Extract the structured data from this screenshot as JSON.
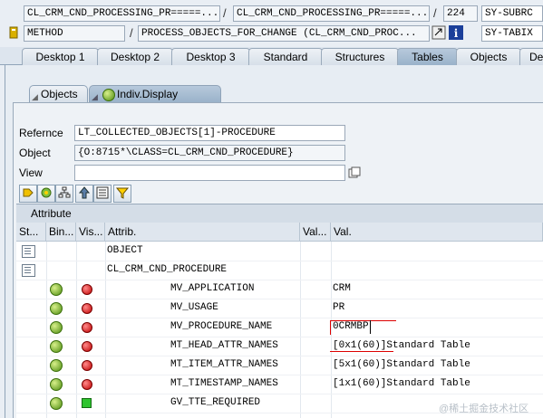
{
  "header": {
    "row1": {
      "field1": "CL_CRM_CND_PROCESSING_PR=====...",
      "field2": "CL_CRM_CND_PROCESSING_PR=====...",
      "separator": "/",
      "line": "224",
      "sysvar": "SY-SUBRC"
    },
    "row2": {
      "kind": "METHOD",
      "method": "PROCESS_OBJECTS_FOR_CHANGE (CL_CRM_CND_PROC...",
      "separator": "/",
      "sysvar": "SY-TABIX"
    }
  },
  "desktop_tabs": [
    "Desktop 1",
    "Desktop 2",
    "Desktop 3",
    "Standard",
    "Structures",
    "Tables",
    "Objects",
    "De"
  ],
  "active_desktop_tab": "Tables",
  "sub_tabs": {
    "objects": "Objects",
    "indiv_display": "Indiv.Display"
  },
  "form": {
    "reference_label": "Refernce",
    "reference_value": "LT_COLLECTED_OBJECTS[1]-PROCEDURE",
    "object_label": "Object",
    "object_value": "{O:8715*\\CLASS=CL_CRM_CND_PROCEDURE}",
    "view_label": "View",
    "view_value": ""
  },
  "section_title": "Attribute",
  "grid": {
    "headers": [
      "St...",
      "Bin...",
      "Vis...",
      "Attrib.",
      "Val...",
      "Val."
    ],
    "rows": [
      {
        "st": "struct",
        "bin": "",
        "vis": "",
        "attrib": "OBJECT",
        "val": ""
      },
      {
        "st": "struct",
        "bin": "",
        "vis": "",
        "attrib": "CL_CRM_CND_PROCEDURE",
        "val": ""
      },
      {
        "st": "",
        "bin": "green",
        "vis": "red",
        "attrib": "MV_APPLICATION",
        "val": "CRM"
      },
      {
        "st": "",
        "bin": "green",
        "vis": "red",
        "attrib": "MV_USAGE",
        "val": "PR"
      },
      {
        "st": "",
        "bin": "green",
        "vis": "red",
        "attrib": "MV_PROCEDURE_NAME",
        "val": "0CRMBP"
      },
      {
        "st": "",
        "bin": "green",
        "vis": "red",
        "attrib": "MT_HEAD_ATTR_NAMES",
        "val": "[0x1(60)]Standard Table"
      },
      {
        "st": "",
        "bin": "green",
        "vis": "red",
        "attrib": "MT_ITEM_ATTR_NAMES",
        "val": "[5x1(60)]Standard Table"
      },
      {
        "st": "",
        "bin": "green",
        "vis": "red",
        "attrib": "MT_TIMESTAMP_NAMES",
        "val": "[1x1(60)]Standard Table"
      },
      {
        "st": "",
        "bin": "green",
        "vis": "green-square",
        "attrib": "GV_TTE_REQUIRED",
        "val": ""
      }
    ]
  },
  "watermark": "@稀土掘金技术社区"
}
